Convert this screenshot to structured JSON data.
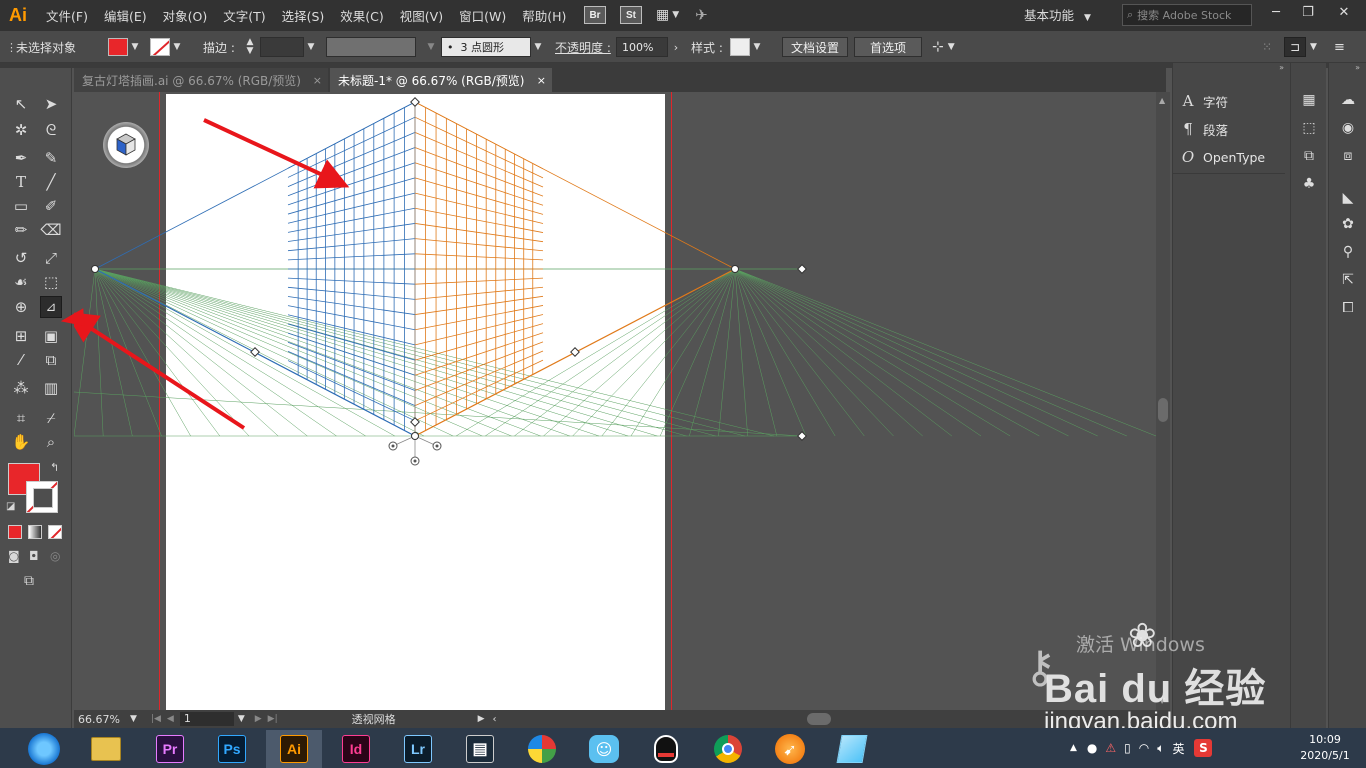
{
  "app": {
    "logo": "Ai"
  },
  "menu": [
    "文件(F)",
    "编辑(E)",
    "对象(O)",
    "文字(T)",
    "选择(S)",
    "效果(C)",
    "视图(V)",
    "窗口(W)",
    "帮助(H)"
  ],
  "badges": {
    "bridge": "Br",
    "stock": "St"
  },
  "workspace": "基本功能",
  "search": {
    "placeholder": "搜索 Adobe Stock"
  },
  "control_bar": {
    "selection": "未选择对象",
    "fill_color": "#e8262a",
    "stroke_label": "描边 :",
    "brush_value": "3 点圆形",
    "opacity_label": "不透明度 :",
    "opacity_value": "100%",
    "style_label": "样式 :",
    "doc_setup": "文档设置",
    "preferences": "首选项"
  },
  "tabs": [
    {
      "label": "复古灯塔插画.ai @ 66.67% (RGB/预览)",
      "close": "×",
      "active": false
    },
    {
      "label": "未标题-1* @ 66.67% (RGB/预览)",
      "close": "×",
      "active": true
    }
  ],
  "tools": [
    "selection-tool",
    "direct-selection-tool",
    "magic-wand-tool",
    "lasso-tool",
    "pen-tool",
    "curvature-tool",
    "type-tool",
    "line-segment-tool",
    "rectangle-tool",
    "shaper-tool",
    "paintbrush-tool",
    "eraser-tool",
    "rotate-tool",
    "scale-tool",
    "warp-tool",
    "free-transform-tool",
    "shape-builder-tool",
    "perspective-grid-tool",
    "mesh-tool",
    "gradient-tool",
    "eyedropper-tool",
    "blend-tool",
    "symbol-sprayer-tool",
    "column-graph-tool",
    "artboard-tool",
    "slice-tool",
    "hand-tool",
    "zoom-tool"
  ],
  "colors": {
    "fill": "#e8262a",
    "accent": "#ff9a00",
    "bleed_line": "#e0262a",
    "grid_left": "#2e6db5",
    "grid_right": "#e07a1a",
    "grid_ground": "#5aa060"
  },
  "status_bar": {
    "zoom": "66.67%",
    "page": "1",
    "tool_name": "透视网格"
  },
  "character_panel": [
    {
      "label": "字符",
      "icon": "character-icon"
    },
    {
      "label": "段落",
      "icon": "paragraph-icon"
    },
    {
      "label": "OpenType",
      "icon": "opentype-icon"
    }
  ],
  "watermark": {
    "line1": "激活 Windows",
    "brand": "Bai du 经验",
    "url": "jingyan.baidu.com"
  },
  "taskbar": {
    "apps": [
      {
        "name": "Pr",
        "color": "#2a1040",
        "fg": "#e77bff"
      },
      {
        "name": "Ps",
        "color": "#061d33",
        "fg": "#31a8ff"
      },
      {
        "name": "Ai",
        "color": "#2d1a04",
        "fg": "#ff9a00"
      },
      {
        "name": "Id",
        "color": "#2b0418",
        "fg": "#ff3d93"
      },
      {
        "name": "Lr",
        "color": "#0b1c2b",
        "fg": "#7ec8ff"
      }
    ],
    "ime": "英",
    "time": "10:09",
    "date": "2020/5/1"
  }
}
